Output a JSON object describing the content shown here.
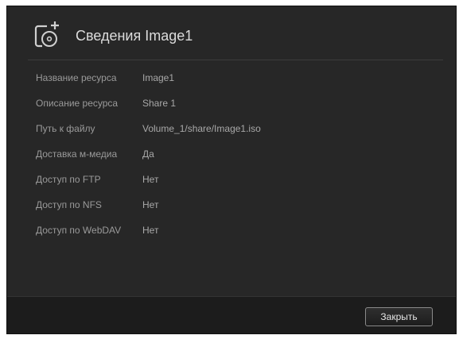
{
  "dialog": {
    "title": "Сведения Image1",
    "icon": "add-share-folder-icon"
  },
  "details": [
    {
      "label": "Название ресурса",
      "value": "Image1"
    },
    {
      "label": "Описание ресурса",
      "value": "Share 1"
    },
    {
      "label": "Путь к файлу",
      "value": "Volume_1/share/Image1.iso"
    },
    {
      "label": "Доставка м-медиа",
      "value": "Да"
    },
    {
      "label": "Доступ по FTP",
      "value": "Нет"
    },
    {
      "label": "Доступ по NFS",
      "value": "Нет"
    },
    {
      "label": "Доступ по WebDAV",
      "value": "Нет"
    }
  ],
  "footer": {
    "close_label": "Закрыть"
  },
  "colors": {
    "dialog_background": "#272727",
    "footer_background": "#1c1c1c",
    "label_text": "#9a9a9a",
    "title_text": "#dcdcdc"
  }
}
